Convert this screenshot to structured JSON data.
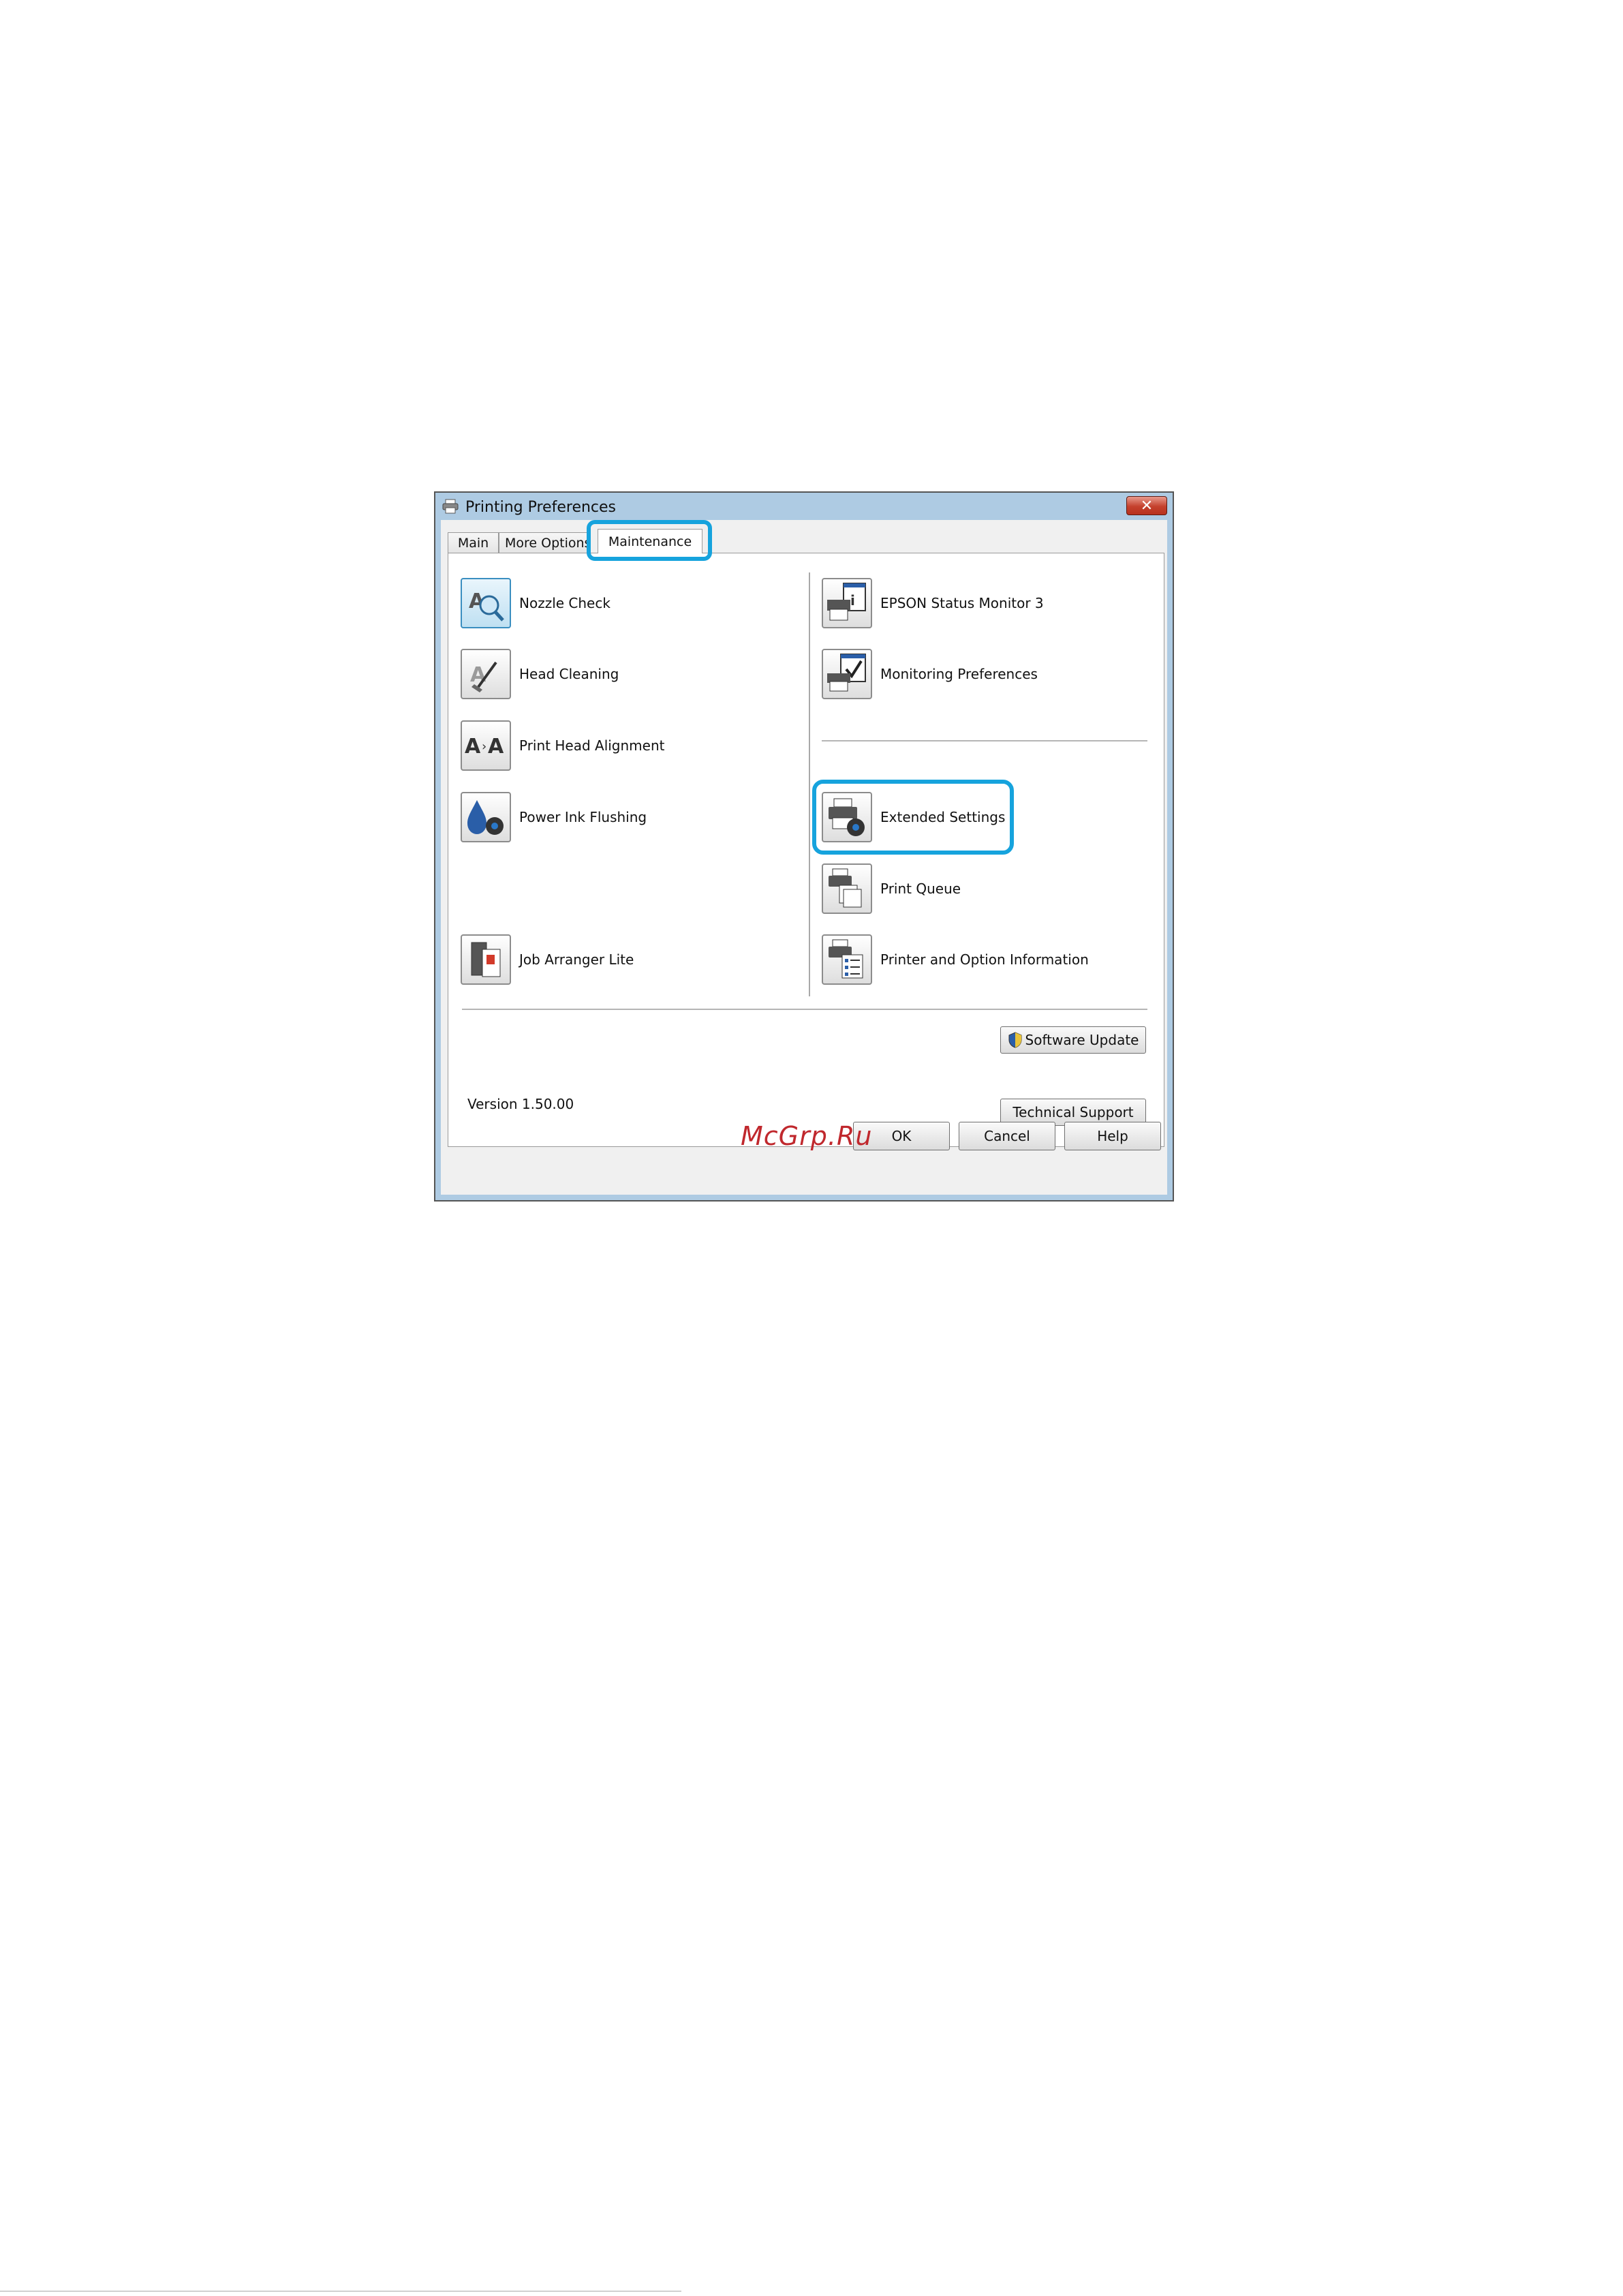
{
  "window": {
    "title": "Printing Preferences",
    "close_symbol": "✕"
  },
  "tabs": [
    {
      "label": "Main"
    },
    {
      "label": "More Options"
    },
    {
      "label": "Maintenance",
      "selected": true
    }
  ],
  "left_items": [
    {
      "label": "Nozzle Check",
      "icon": "nozzle-check-icon"
    },
    {
      "label": "Head Cleaning",
      "icon": "head-cleaning-icon"
    },
    {
      "label": "Print Head Alignment",
      "icon": "alignment-icon"
    },
    {
      "label": "Power Ink Flushing",
      "icon": "ink-flushing-icon"
    },
    {
      "label": "Job Arranger Lite",
      "icon": "job-arranger-icon"
    }
  ],
  "right_items": [
    {
      "label": "EPSON Status Monitor 3",
      "icon": "status-monitor-icon"
    },
    {
      "label": "Monitoring Preferences",
      "icon": "monitoring-prefs-icon"
    },
    {
      "label": "Extended Settings",
      "icon": "extended-settings-icon",
      "highlighted": true
    },
    {
      "label": "Print Queue",
      "icon": "print-queue-icon"
    },
    {
      "label": "Printer and Option Information",
      "icon": "printer-info-icon"
    }
  ],
  "buttons": {
    "software_update": "Software Update",
    "technical_support": "Technical Support",
    "ok": "OK",
    "cancel": "Cancel",
    "help": "Help"
  },
  "version": "Version 1.50.00",
  "watermark": "McGrp.Ru",
  "colors": {
    "highlight": "#16a3dd",
    "watermark": "#c0282d"
  }
}
